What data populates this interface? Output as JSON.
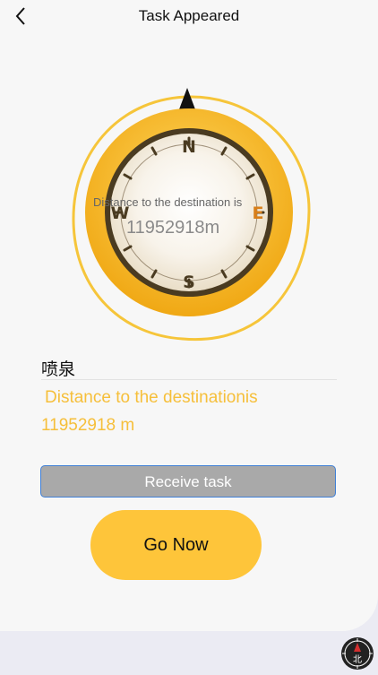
{
  "header": {
    "title": "Task Appeared"
  },
  "compass": {
    "north": "N",
    "east": "E",
    "south": "S",
    "west": "W",
    "distance_label": "Distance to the destination is",
    "distance_value": "11952918m"
  },
  "destination": {
    "name": "喷泉",
    "distance_line1": "Distance to the destinationis",
    "distance_line2": "11952918 m"
  },
  "actions": {
    "receive_label": "Receive task",
    "go_label": "Go Now"
  },
  "mini_compass": {
    "label": "北"
  },
  "colors": {
    "accent_yellow": "#fec53a",
    "text_yellow": "#f6bf3a",
    "compass_ring": "#f4b21f",
    "dial_dark": "#4a3b21",
    "east_orange": "#d87f1a"
  }
}
